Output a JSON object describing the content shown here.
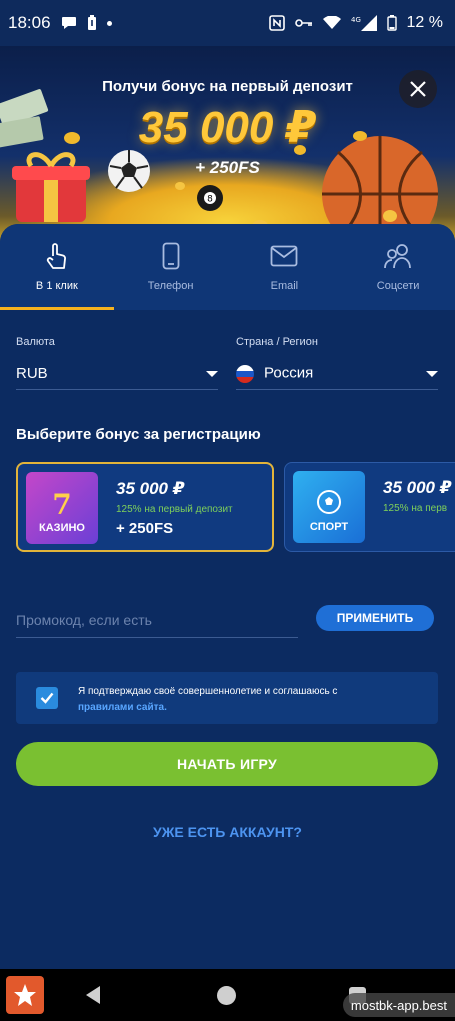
{
  "status_bar": {
    "time": "18:06",
    "network": "4G",
    "battery_percent": "12 %"
  },
  "banner": {
    "subtitle": "Получи бонус на первый депозит",
    "amount": "35 000 ₽",
    "free_spins": "+ 250FS"
  },
  "tabs": [
    {
      "label": "В 1 клик",
      "icon": "tap-icon",
      "active": true
    },
    {
      "label": "Телефон",
      "icon": "phone-icon",
      "active": false
    },
    {
      "label": "Email",
      "icon": "mail-icon",
      "active": false
    },
    {
      "label": "Соцсети",
      "icon": "users-icon",
      "active": false
    }
  ],
  "form": {
    "currency_label": "Валюта",
    "currency_value": "RUB",
    "country_label": "Страна / Регион",
    "country_value": "Россия"
  },
  "bonus_section": {
    "title": "Выберите бонус за регистрацию",
    "cards": [
      {
        "badge": "КАЗИНО",
        "amount": "35 000 ₽",
        "desc": "125% на первый депозит",
        "fs": "+ 250FS",
        "selected": true
      },
      {
        "badge": "СПОРТ",
        "amount": "35 000 ₽",
        "desc": "125% на перв",
        "selected": false
      }
    ]
  },
  "promo": {
    "placeholder": "Промокод, если есть",
    "apply_label": "ПРИМЕНИТЬ"
  },
  "consent": {
    "checked": true,
    "text": "Я подтверждаю своё совершеннолетие и соглашаюсь с",
    "link": "правилами сайта."
  },
  "start_button": "НАЧАТЬ ИГРУ",
  "have_account": "УЖЕ ЕСТЬ АККАУНТ?",
  "watermark": "mostbk-app.best",
  "colors": {
    "background": "#0c2b61",
    "accent_gold": "#f5b21f",
    "start_green": "#7ac031",
    "apply_blue": "#1f6fd6",
    "link_blue": "#4d94f0",
    "bonus_green": "#7fd15a"
  }
}
